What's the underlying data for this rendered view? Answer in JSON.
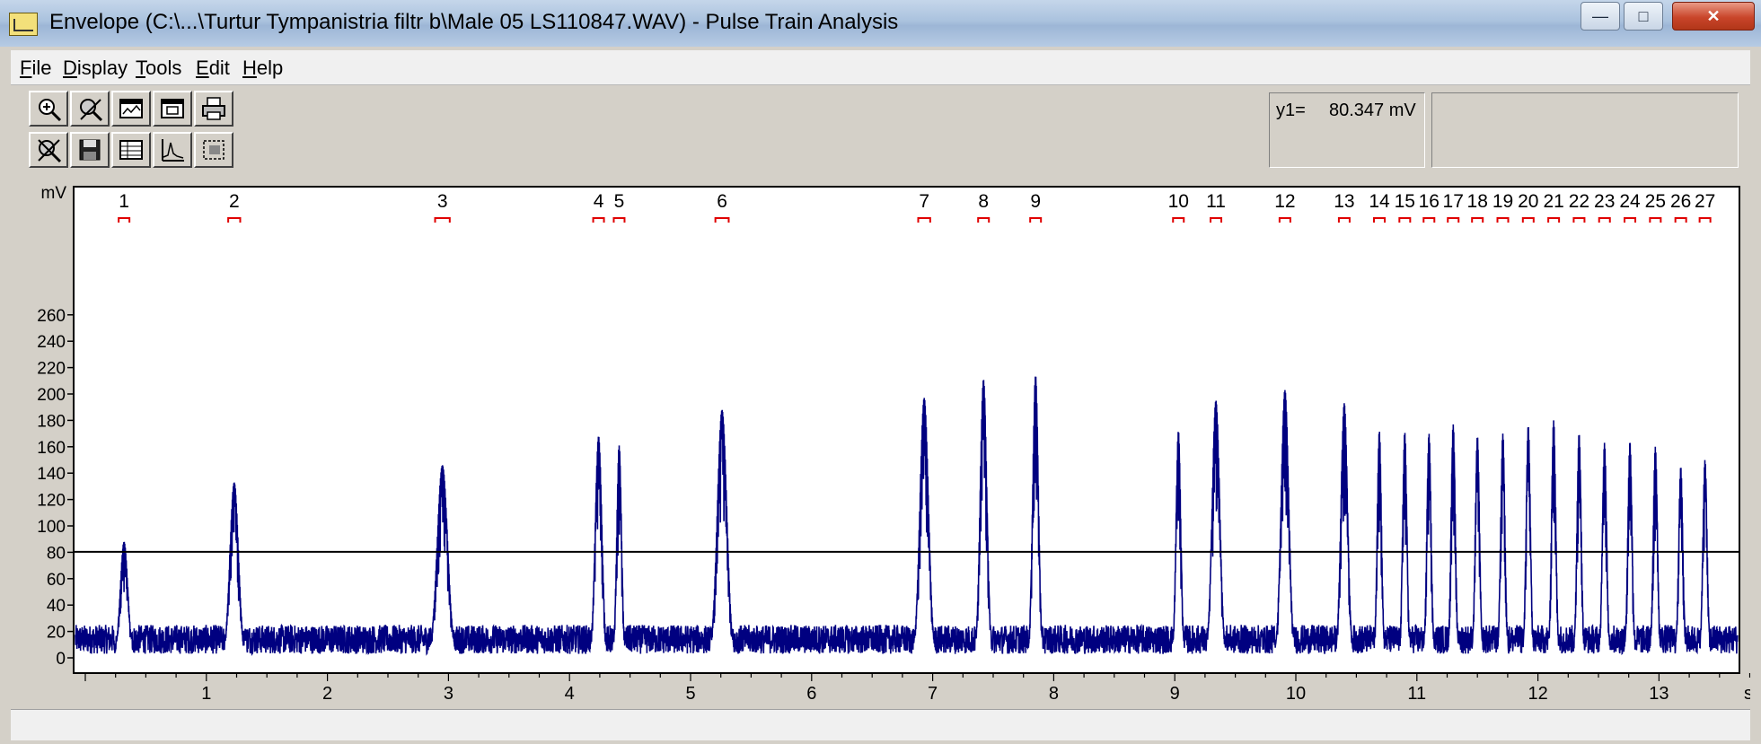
{
  "window": {
    "title": "Envelope  (C:\\...\\Turtur Tympanistria filtr b\\Male 05 LS110847.WAV) - Pulse Train Analysis",
    "min_symbol": "—",
    "max_symbol": "□",
    "close_symbol": "✕"
  },
  "menu": [
    {
      "key": "F",
      "rest": "ile"
    },
    {
      "key": "D",
      "rest": "isplay"
    },
    {
      "key": "T",
      "rest": "ools"
    },
    {
      "key": "E",
      "rest": "dit"
    },
    {
      "key": "H",
      "rest": "elp"
    }
  ],
  "toolbar": {
    "icons": [
      "zoom-in-icon",
      "zoom-tool-icon",
      "display-window-icon",
      "calendar-window-icon",
      "printer-icon",
      "zoom-off-icon",
      "save-disk-icon",
      "table-icon",
      "spectrum-icon",
      "select-region-icon"
    ]
  },
  "readout": {
    "label": "y1=",
    "value": "80.347 mV"
  },
  "colors": {
    "signal": "#000080",
    "cursor_line": "#000000",
    "marker": "#e00000",
    "plot_bg": "#ffffff"
  },
  "chart_data": {
    "type": "line",
    "title": "",
    "ylabel": "mV",
    "xlabel": "s",
    "xlim": [
      0,
      13.75
    ],
    "ylim": [
      -5,
      270
    ],
    "y_ticks": [
      0,
      20,
      40,
      60,
      80,
      100,
      120,
      140,
      160,
      180,
      200,
      220,
      240,
      260
    ],
    "x_ticks": [
      1,
      2,
      3,
      4,
      5,
      6,
      7,
      8,
      9,
      10,
      11,
      12,
      13
    ],
    "cursor_y1": 80.347,
    "baseline_mV": 14,
    "pulses": [
      {
        "label": "1",
        "t": 0.32,
        "peak": 88,
        "width": 0.08
      },
      {
        "label": "2",
        "t": 1.23,
        "peak": 133,
        "width": 0.09
      },
      {
        "label": "3",
        "t": 2.95,
        "peak": 146,
        "width": 0.11
      },
      {
        "label": "4",
        "t": 4.24,
        "peak": 168,
        "width": 0.07
      },
      {
        "label": "5",
        "t": 4.41,
        "peak": 161,
        "width": 0.05
      },
      {
        "label": "6",
        "t": 5.26,
        "peak": 188,
        "width": 0.1
      },
      {
        "label": "7",
        "t": 6.93,
        "peak": 197,
        "width": 0.09
      },
      {
        "label": "8",
        "t": 7.42,
        "peak": 211,
        "width": 0.07
      },
      {
        "label": "9",
        "t": 7.85,
        "peak": 214,
        "width": 0.06
      },
      {
        "label": "10",
        "t": 9.03,
        "peak": 172,
        "width": 0.05
      },
      {
        "label": "11",
        "t": 9.34,
        "peak": 195,
        "width": 0.08
      },
      {
        "label": "12",
        "t": 9.91,
        "peak": 203,
        "width": 0.08
      },
      {
        "label": "13",
        "t": 10.4,
        "peak": 193,
        "width": 0.07
      },
      {
        "label": "14",
        "t": 10.69,
        "peak": 172,
        "width": 0.045
      },
      {
        "label": "15",
        "t": 10.9,
        "peak": 171,
        "width": 0.045
      },
      {
        "label": "16",
        "t": 11.1,
        "peak": 170,
        "width": 0.045
      },
      {
        "label": "17",
        "t": 11.3,
        "peak": 177,
        "width": 0.045
      },
      {
        "label": "18",
        "t": 11.5,
        "peak": 168,
        "width": 0.045
      },
      {
        "label": "19",
        "t": 11.71,
        "peak": 170,
        "width": 0.045
      },
      {
        "label": "20",
        "t": 11.92,
        "peak": 176,
        "width": 0.045
      },
      {
        "label": "21",
        "t": 12.13,
        "peak": 180,
        "width": 0.045
      },
      {
        "label": "22",
        "t": 12.34,
        "peak": 170,
        "width": 0.045
      },
      {
        "label": "23",
        "t": 12.55,
        "peak": 163,
        "width": 0.045
      },
      {
        "label": "24",
        "t": 12.76,
        "peak": 164,
        "width": 0.045
      },
      {
        "label": "25",
        "t": 12.97,
        "peak": 160,
        "width": 0.045
      },
      {
        "label": "26",
        "t": 13.18,
        "peak": 145,
        "width": 0.045
      },
      {
        "label": "27",
        "t": 13.38,
        "peak": 150,
        "width": 0.045
      }
    ]
  }
}
